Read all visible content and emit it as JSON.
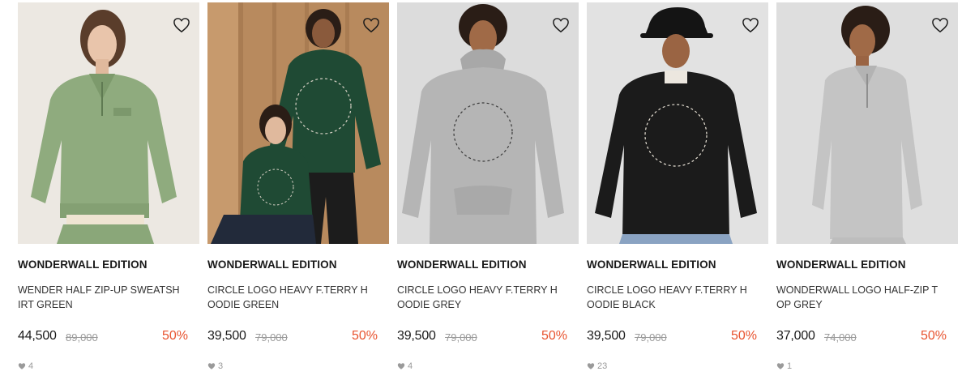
{
  "products": [
    {
      "brand": "WONDERWALL EDITION",
      "name": "WENDER HALF ZIP-UP SWEATSHIRT GREEN",
      "price": "44,500",
      "original_price": "89,000",
      "discount": "50%",
      "likes": "4",
      "image": "model-green-half-zip",
      "garment_color": "#8fab7e"
    },
    {
      "brand": "WONDERWALL EDITION",
      "name": "CIRCLE LOGO HEAVY F.TERRY HOODIE GREEN",
      "price": "39,500",
      "original_price": "79,000",
      "discount": "50%",
      "likes": "3",
      "image": "two-models-green-hoodies",
      "garment_color": "#1f4a34"
    },
    {
      "brand": "WONDERWALL EDITION",
      "name": "CIRCLE LOGO HEAVY F.TERRY HOODIE GREY",
      "price": "39,500",
      "original_price": "79,000",
      "discount": "50%",
      "likes": "4",
      "image": "model-grey-hoodie",
      "garment_color": "#b5b5b5"
    },
    {
      "brand": "WONDERWALL EDITION",
      "name": "CIRCLE LOGO HEAVY F.TERRY HOODIE BLACK",
      "price": "39,500",
      "original_price": "79,000",
      "discount": "50%",
      "likes": "23",
      "image": "model-black-hoodie-cap",
      "garment_color": "#1b1b1b"
    },
    {
      "brand": "WONDERWALL EDITION",
      "name": "WONDERWALL LOGO HALF-ZIP TOP GREY",
      "price": "37,000",
      "original_price": "74,000",
      "discount": "50%",
      "likes": "1",
      "image": "model-grey-half-zip",
      "garment_color": "#c4c4c4"
    }
  ],
  "colors": {
    "discount": "#e8532f",
    "muted": "#9a9a9a",
    "text": "#1a1a1a"
  }
}
